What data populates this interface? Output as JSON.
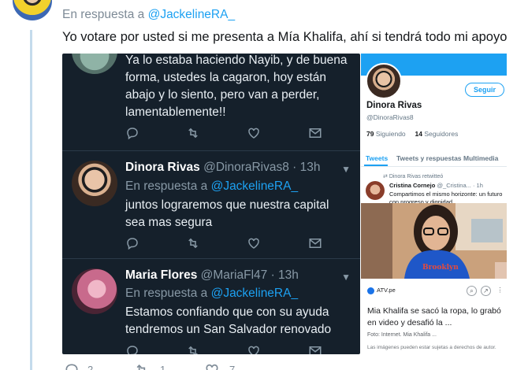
{
  "reply": {
    "prefix": "En respuesta a",
    "mention": "@JackelineRA_",
    "text": "Yo votare por usted si me presenta a Mía Khalifa, ahí si tendrá todo mi apoyo"
  },
  "embedded_tweets": [
    {
      "text": "Ya lo estaba haciendo Nayib, y de buena forma, ustedes la cagaron, hoy están abajo y lo siento, pero van a perder, lamentablemente!!"
    },
    {
      "name": "Dinora Rivas",
      "handle": "@DinoraRivas8 · 13h",
      "reply_prefix": "En respuesta a",
      "mention": "@JackelineRA_",
      "text": "juntos lograremos que nuestra capital sea mas segura"
    },
    {
      "name": "Maria Flores",
      "handle": "@MariaFl47 · 13h",
      "reply_prefix": "En respuesta a",
      "mention": "@JackelineRA_",
      "text": "Estamos confiando que con su ayuda tendremos un San Salvador renovado"
    }
  ],
  "profile_panel": {
    "follow_label": "Seguir",
    "name": "Dinora Rivas",
    "handle": "@DinoraRivas8",
    "following_count": "79",
    "following_label": "Siguiendo",
    "followers_count": "14",
    "followers_label": "Seguidores",
    "tabs": [
      "Tweets",
      "Tweets y respuestas",
      "Multimedia"
    ],
    "retweet_note": "Dinora Rivas retwitteó",
    "post_name": "Cristina Cornejo",
    "post_handle": "@_Cristina... · 1h",
    "post_text": "Compartimos el mismo horizonte: un futuro con progreso y dignidad"
  },
  "search_result": {
    "source": "ATV.pe",
    "title": "Mia Khalifa se sacó la ropa, lo grabó en video y desafió la ...",
    "meta": "Foto: Internet. Mia Khalifa ...",
    "note": "Las imágenes pueden estar sujetas a derechos de autor."
  },
  "outer_actions": {
    "reply_count": "2",
    "retweet_count": "1",
    "like_count": "7"
  },
  "colors": {
    "twitter_blue": "#1da1f2",
    "dark_bg": "#15202b",
    "muted": "#8899a6"
  }
}
